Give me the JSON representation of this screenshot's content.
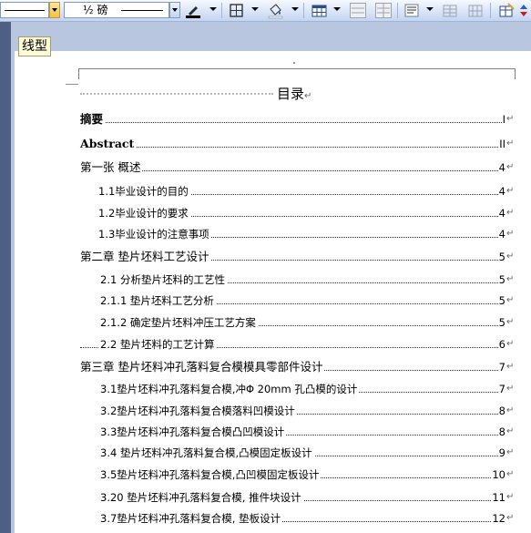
{
  "toolbar": {
    "line_weight": "½ 磅",
    "tooltip": "线型"
  },
  "toc": {
    "title": "目录",
    "return_mark": "↵",
    "entries": [
      {
        "text": "摘要",
        "page": "I"
      },
      {
        "text": "Abstract",
        "page": "II"
      },
      {
        "text": "第一张  概述",
        "page": "4"
      },
      {
        "text": "1.1毕业设计的目的",
        "page": "4"
      },
      {
        "text": "1.2毕业设计的要求",
        "page": "4"
      },
      {
        "text": "1.3毕业设计的注意事项",
        "page": "4"
      },
      {
        "text": "第二章  垫片坯料工艺设计",
        "page": "5"
      },
      {
        "text": "2.1 分析垫片坯料的工艺性",
        "page": "5"
      },
      {
        "text": "2.1.1 垫片坯料工艺分析",
        "page": "5"
      },
      {
        "text": "2.1.2 确定垫片坯料冲压工艺方案",
        "page": "5"
      },
      {
        "text": "2.2 垫片坯料的工艺计算",
        "page": "6"
      },
      {
        "text": "第三章 垫片坯料冲孔落料复合模模具零部件设计",
        "page": "7"
      },
      {
        "text": "3.1垫片坯料冲孔落料复合模,冲Φ 20mm 孔凸模的设计",
        "page": "7"
      },
      {
        "text": "3.2垫片坯料冲孔落料复合模落料凹模设计",
        "page": "8"
      },
      {
        "text": "3.3垫片坯料冲孔落料复合模凸凹模设计",
        "page": "8"
      },
      {
        "text": "3.4 垫片坯料冲孔落料复合模,凸模固定板设计",
        "page": "9"
      },
      {
        "text": "3.5垫片坯料冲孔落料复合模,凸凹模固定板设计",
        "page": "10"
      },
      {
        "text": "3.20 垫片坯料冲孔落料复合模, 推件块设计",
        "page": "11"
      },
      {
        "text": "3.7垫片坯料冲孔落料复合模, 垫板设计",
        "page": "12"
      }
    ]
  },
  "colors": {
    "toolbar": "#d7e3f7",
    "canvas": "#b9c6df",
    "page": "#ffffff",
    "tooltip": "#fdfbd8"
  }
}
